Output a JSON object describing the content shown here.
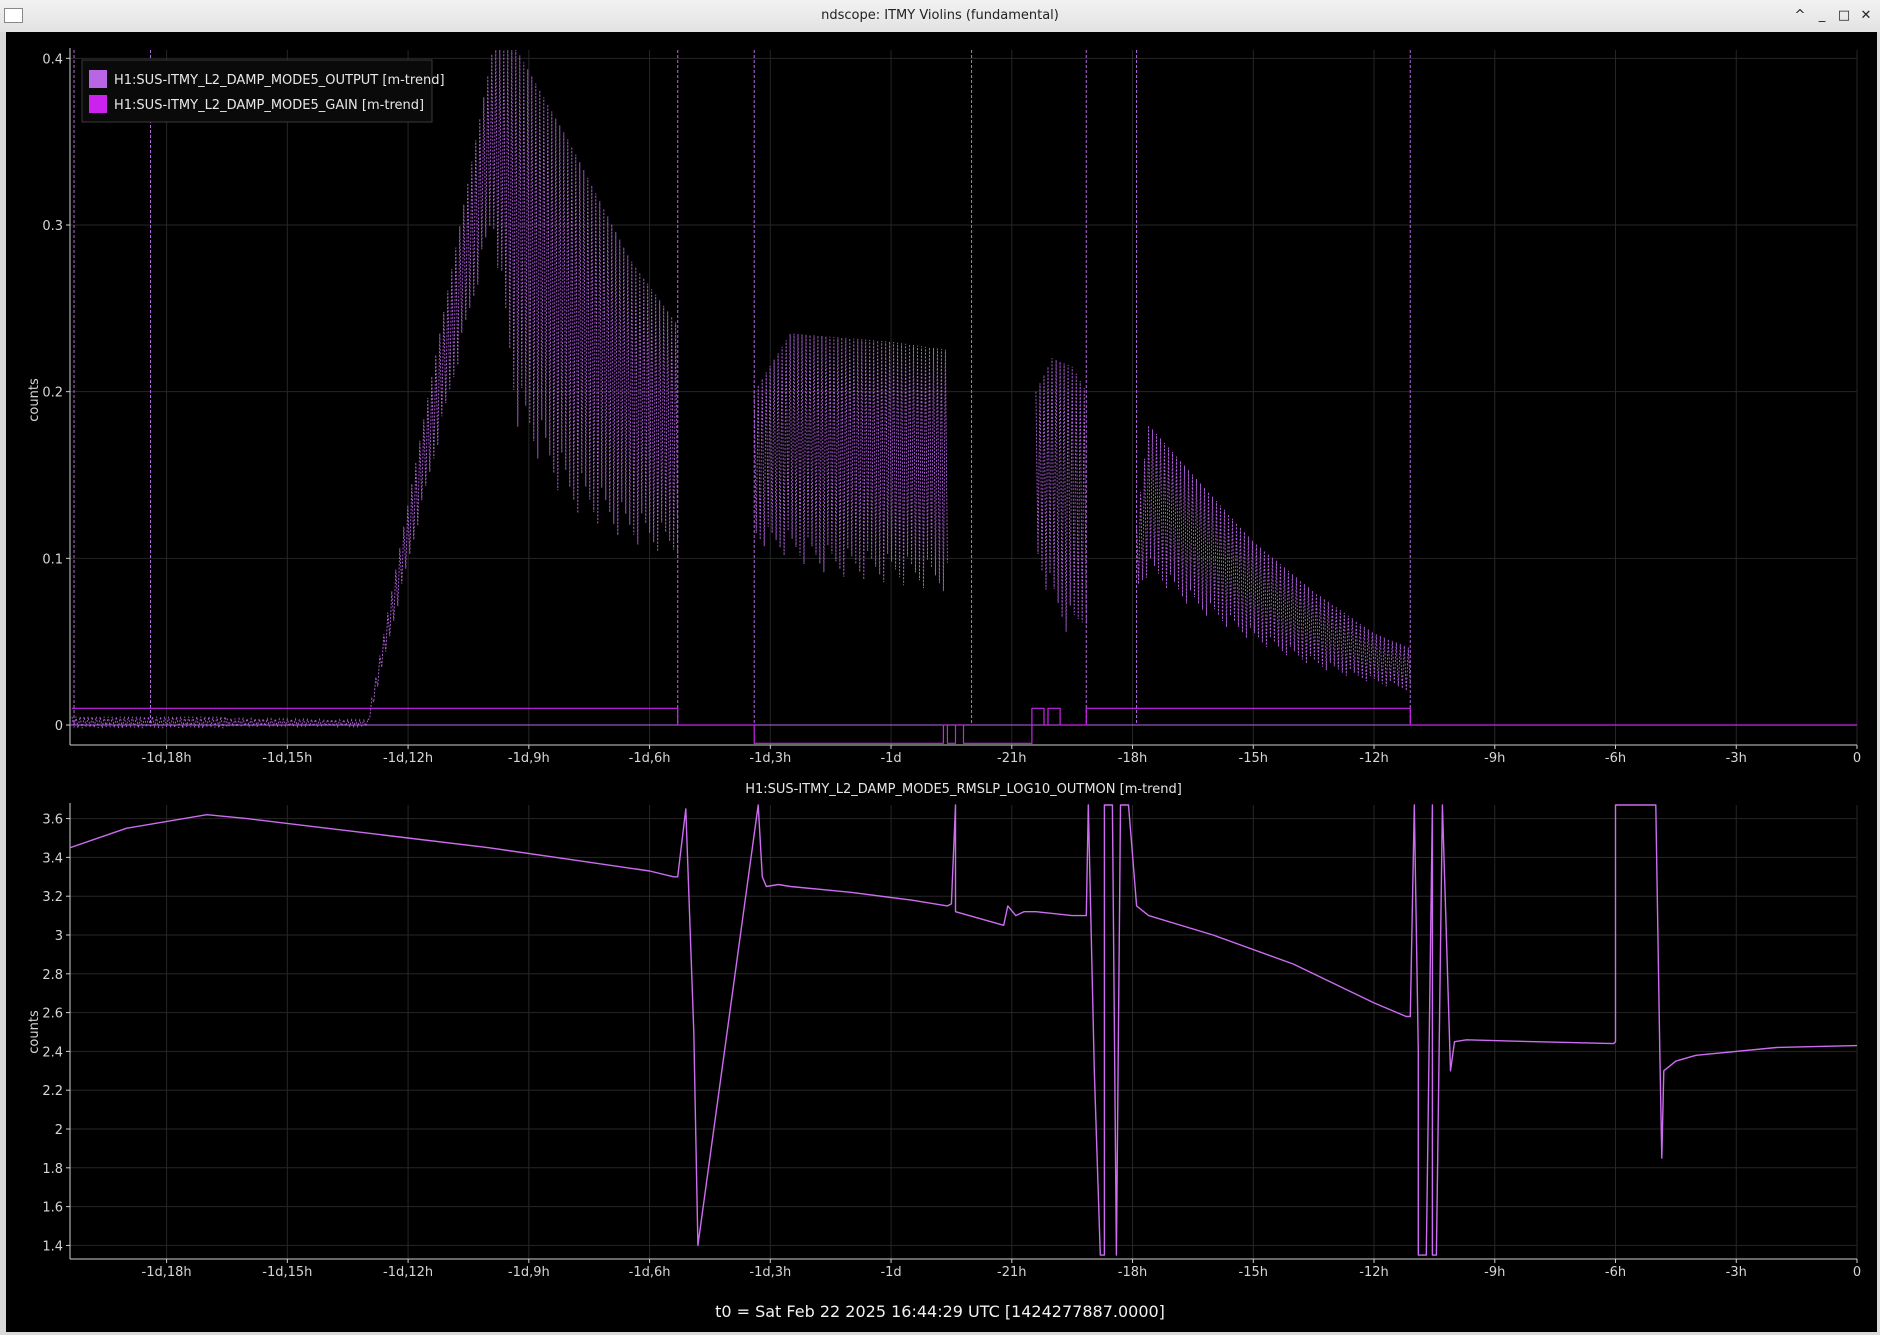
{
  "window": {
    "title": "ndscope: ITMY Violins (fundamental)",
    "buttons": {
      "shade": "^",
      "minimize": "_",
      "maximize": "□",
      "close": "✕"
    }
  },
  "colors": {
    "output": "#b866e6",
    "gain": "#cc22ee",
    "rms": "#cc6cf0",
    "background": "#000000",
    "grid": "#262626",
    "axis": "#cfcfcf"
  },
  "t0_label": "t0 = Sat Feb 22 2025 16:44:29 UTC [1424277887.0000]",
  "chart_data": [
    {
      "type": "line",
      "title": "",
      "ylabel": "counts",
      "xlabel": "",
      "x_unit": "hours relative to t0",
      "xlim": [
        -44.4,
        0
      ],
      "ylim": [
        -0.012,
        0.405
      ],
      "grid": true,
      "legend_position": "top-left",
      "y_ticks": [
        {
          "v": 0,
          "label": "0"
        },
        {
          "v": 0.1,
          "label": "0.1"
        },
        {
          "v": 0.2,
          "label": "0.2"
        },
        {
          "v": 0.3,
          "label": "0.3"
        },
        {
          "v": 0.4,
          "label": "0.4"
        }
      ],
      "x_ticks": [
        {
          "v": -42,
          "label": "-1d,18h"
        },
        {
          "v": -39,
          "label": "-1d,15h"
        },
        {
          "v": -36,
          "label": "-1d,12h"
        },
        {
          "v": -33,
          "label": "-1d,9h"
        },
        {
          "v": -30,
          "label": "-1d,6h"
        },
        {
          "v": -27,
          "label": "-1d,3h"
        },
        {
          "v": -24,
          "label": "-1d"
        },
        {
          "v": -21,
          "label": "-21h"
        },
        {
          "v": -18,
          "label": "-18h"
        },
        {
          "v": -15,
          "label": "-15h"
        },
        {
          "v": -12,
          "label": "-12h"
        },
        {
          "v": -9,
          "label": "-9h"
        },
        {
          "v": -6,
          "label": "-6h"
        },
        {
          "v": -3,
          "label": "-3h"
        },
        {
          "v": 0,
          "label": "0"
        }
      ],
      "series": [
        {
          "name": "H1:SUS-ITMY_L2_DAMP_MODE5_OUTPUT [m-trend]",
          "color": "#b866e6",
          "style": "min-max envelope",
          "segments": [
            {
              "x": [
                -44.35,
                -40.5
              ],
              "max": [
                0.005,
                0.005
              ],
              "min": [
                -0.002,
                -0.002
              ]
            },
            {
              "x": [
                -40.5,
                -37.0
              ],
              "max": [
                0.004,
                0.003
              ],
              "min": [
                -0.001,
                -0.001
              ]
            },
            {
              "x": [
                -37.0,
                -33.9,
                -33.3,
                -32.0,
                -30.5,
                -29.3
              ],
              "max": [
                0.003,
                0.405,
                0.405,
                0.35,
                0.28,
                0.24
              ],
              "min": [
                -0.001,
                0.3,
                0.18,
                0.13,
                0.11,
                0.1
              ]
            },
            {
              "x": [
                -27.4,
                -26.5,
                -25.5,
                -24.0,
                -22.6
              ],
              "max": [
                0.2,
                0.235,
                0.233,
                0.23,
                0.225
              ],
              "min": [
                0.11,
                0.1,
                0.09,
                0.085,
                0.08
              ]
            },
            {
              "x": [
                -20.4,
                -20.0,
                -19.5,
                -19.15
              ],
              "max": [
                0.2,
                0.22,
                0.215,
                0.2
              ],
              "min": [
                0.1,
                0.07,
                0.05,
                0.06
              ]
            },
            {
              "x": [
                -17.9,
                -17.6,
                -16.5,
                -15.0,
                -13.5,
                -12.0,
                -11.1
              ],
              "max": [
                0.12,
                0.18,
                0.15,
                0.11,
                0.08,
                0.055,
                0.046
              ],
              "min": [
                0.08,
                0.09,
                0.07,
                0.05,
                0.035,
                0.025,
                0.02
              ]
            }
          ],
          "spikes": [
            -44.3,
            -42.4,
            -29.3,
            -27.4,
            -22.0,
            -19.15,
            -17.9,
            -11.1
          ]
        },
        {
          "name": "H1:SUS-ITMY_L2_DAMP_MODE5_GAIN [m-trend]",
          "color": "#cc22ee",
          "style": "step",
          "x": [
            -44.35,
            -42.4,
            -42.4,
            -29.3,
            -29.3,
            -27.4,
            -27.4,
            -22.7,
            -22.7,
            -22.6,
            -22.6,
            -22.4,
            -22.4,
            -22.2,
            -22.2,
            -20.5,
            -20.5,
            -20.2,
            -20.2,
            -20.1,
            -20.1,
            -19.8,
            -19.8,
            -19.15,
            -19.15,
            -17.9,
            -17.9,
            -11.1,
            -11.1,
            0
          ],
          "y": [
            0.01,
            0.01,
            0.01,
            0.01,
            0,
            0,
            -0.011,
            -0.011,
            0,
            0,
            -0.011,
            -0.011,
            0,
            0,
            -0.011,
            -0.011,
            0.01,
            0.01,
            0,
            0,
            0.01,
            0.01,
            0,
            0,
            0.01,
            0.01,
            0.01,
            0.01,
            0,
            0
          ]
        }
      ]
    },
    {
      "type": "line",
      "title": "H1:SUS-ITMY_L2_DAMP_MODE5_RMSLP_LOG10_OUTMON [m-trend]",
      "ylabel": "counts",
      "xlabel": "",
      "x_unit": "hours relative to t0",
      "xlim": [
        -44.4,
        0
      ],
      "ylim": [
        1.33,
        3.67
      ],
      "grid": true,
      "y_ticks": [
        {
          "v": 1.4,
          "label": "1.4"
        },
        {
          "v": 1.6,
          "label": "1.6"
        },
        {
          "v": 1.8,
          "label": "1.8"
        },
        {
          "v": 2,
          "label": "2"
        },
        {
          "v": 2.2,
          "label": "2.2"
        },
        {
          "v": 2.4,
          "label": "2.4"
        },
        {
          "v": 2.6,
          "label": "2.6"
        },
        {
          "v": 2.8,
          "label": "2.8"
        },
        {
          "v": 3,
          "label": "3"
        },
        {
          "v": 3.2,
          "label": "3.2"
        },
        {
          "v": 3.4,
          "label": "3.4"
        },
        {
          "v": 3.6,
          "label": "3.6"
        }
      ],
      "x_ticks": [
        {
          "v": -42,
          "label": "-1d,18h"
        },
        {
          "v": -39,
          "label": "-1d,15h"
        },
        {
          "v": -36,
          "label": "-1d,12h"
        },
        {
          "v": -33,
          "label": "-1d,9h"
        },
        {
          "v": -30,
          "label": "-1d,6h"
        },
        {
          "v": -27,
          "label": "-1d,3h"
        },
        {
          "v": -24,
          "label": "-1d"
        },
        {
          "v": -21,
          "label": "-21h"
        },
        {
          "v": -18,
          "label": "-18h"
        },
        {
          "v": -15,
          "label": "-15h"
        },
        {
          "v": -12,
          "label": "-12h"
        },
        {
          "v": -9,
          "label": "-9h"
        },
        {
          "v": -6,
          "label": "-6h"
        },
        {
          "v": -3,
          "label": "-3h"
        },
        {
          "v": 0,
          "label": "0"
        }
      ],
      "series": [
        {
          "name": "H1:SUS-ITMY_L2_DAMP_MODE5_RMSLP_LOG10_OUTMON [m-trend]",
          "color": "#cc6cf0",
          "x": [
            -44.4,
            -43.0,
            -41.0,
            -40.0,
            -38.0,
            -36.0,
            -34.0,
            -32.0,
            -30.0,
            -29.4,
            -29.3,
            -29.1,
            -28.9,
            -28.8,
            -27.3,
            -27.2,
            -27.1,
            -26.8,
            -26.5,
            -25.0,
            -23.5,
            -22.6,
            -22.5,
            -22.4,
            -22.4,
            -21.2,
            -21.1,
            -20.9,
            -20.7,
            -20.4,
            -19.5,
            -19.15,
            -19.1,
            -18.95,
            -18.8,
            -18.7,
            -18.7,
            -18.5,
            -18.4,
            -18.3,
            -18.1,
            -17.9,
            -17.6,
            -16.0,
            -14.0,
            -12.0,
            -11.2,
            -11.1,
            -11.0,
            -10.9,
            -10.9,
            -10.7,
            -10.55,
            -10.55,
            -10.45,
            -10.3,
            -10.3,
            -10.1,
            -10.0,
            -9.7,
            -8.0,
            -6.05,
            -6.0,
            -6.0,
            -5.9,
            -5.0,
            -4.9,
            -4.85,
            -4.8,
            -4.5,
            -4.0,
            -2.0,
            0.0
          ],
          "y": [
            3.45,
            3.55,
            3.62,
            3.6,
            3.55,
            3.5,
            3.45,
            3.39,
            3.33,
            3.3,
            3.3,
            3.65,
            2.5,
            1.4,
            3.67,
            3.3,
            3.25,
            3.26,
            3.25,
            3.22,
            3.18,
            3.15,
            3.16,
            3.67,
            3.12,
            3.05,
            3.15,
            3.1,
            3.12,
            3.12,
            3.1,
            3.1,
            3.67,
            2.3,
            1.35,
            1.35,
            3.67,
            3.67,
            1.35,
            3.67,
            3.67,
            3.15,
            3.1,
            3.0,
            2.85,
            2.65,
            2.58,
            2.58,
            3.67,
            2.4,
            1.35,
            1.35,
            3.67,
            1.35,
            1.35,
            3.67,
            3.67,
            2.3,
            2.45,
            2.46,
            2.45,
            2.44,
            2.45,
            3.67,
            3.67,
            3.67,
            2.4,
            1.85,
            2.3,
            2.35,
            2.38,
            2.42,
            2.43
          ]
        }
      ]
    }
  ]
}
